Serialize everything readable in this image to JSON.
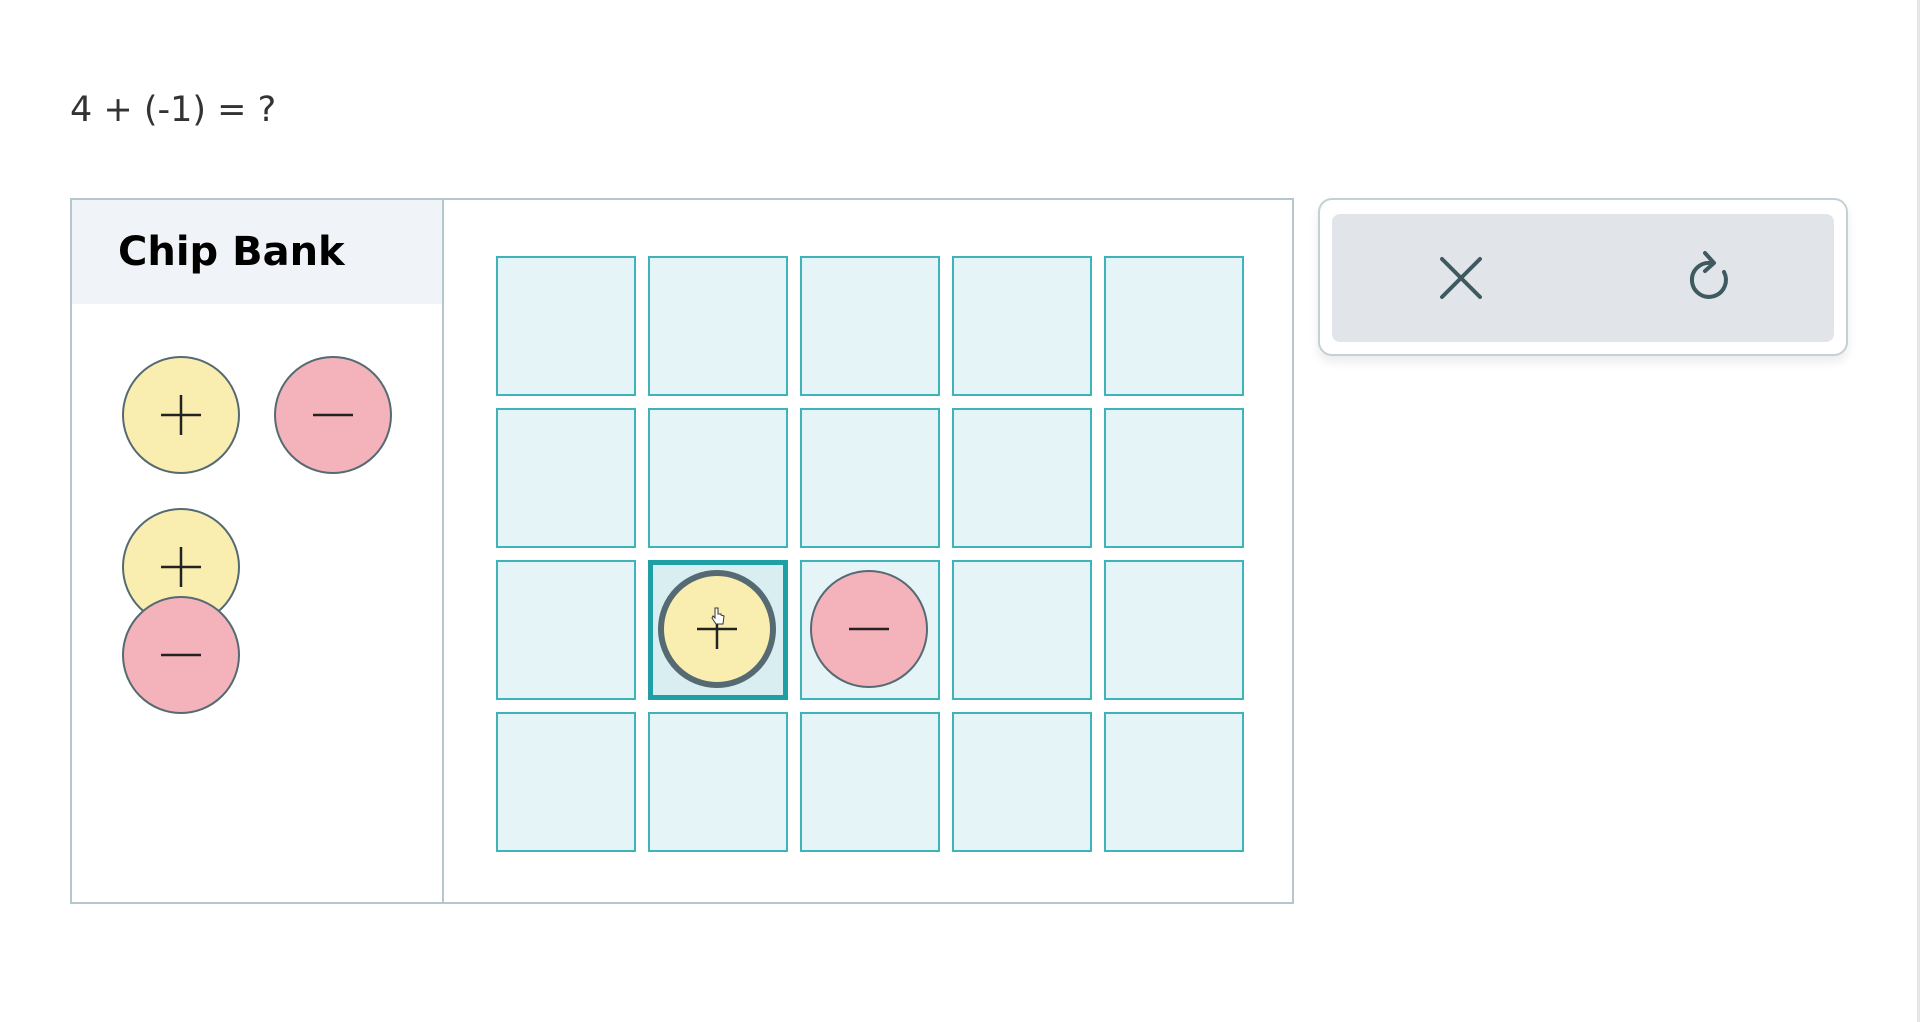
{
  "question": {
    "text": "4 + (-1) = ?"
  },
  "chip_bank": {
    "title": "Chip Bank",
    "chips": [
      {
        "kind": "positive",
        "sign": "+"
      },
      {
        "kind": "negative",
        "sign": "−"
      },
      {
        "kind": "positive",
        "sign": "+"
      },
      {
        "kind": "negative",
        "sign": "−"
      }
    ]
  },
  "board": {
    "rows": 4,
    "cols": 5,
    "placed_chips": [
      {
        "row": 3,
        "col": 2,
        "kind": "positive",
        "selected": true
      },
      {
        "row": 3,
        "col": 3,
        "kind": "negative",
        "selected": false
      }
    ]
  },
  "controls": {
    "clear_icon": "close-icon",
    "reset_icon": "redo-icon"
  },
  "colors": {
    "positive_chip": "#f9eeb0",
    "negative_chip": "#f4b2ba",
    "cell_fill": "#e5f5f7",
    "cell_border": "#3fb3b9",
    "active_cell_border": "#1e9fa6",
    "chip_border": "#556a72"
  }
}
